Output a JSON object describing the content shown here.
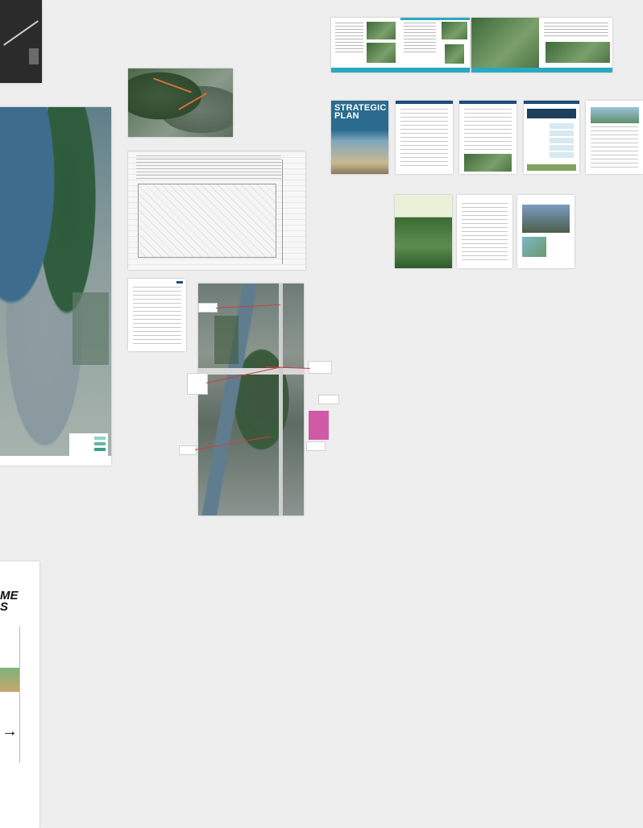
{
  "cards": {
    "strategic_plan": {
      "title_line1": "STRATEGIC",
      "title_line2": "PLAN"
    },
    "left_sign": {
      "text": "ME\nS"
    }
  }
}
